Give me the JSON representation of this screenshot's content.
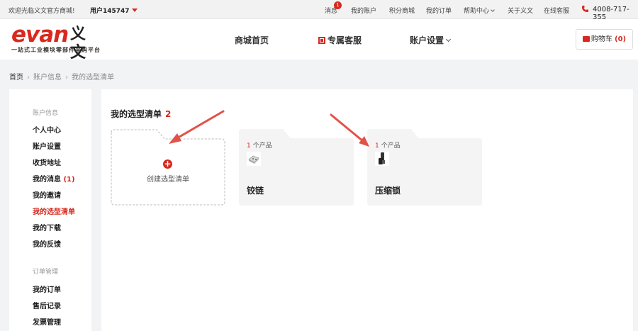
{
  "topbar": {
    "welcome": "欢迎光临义文官方商城!",
    "user": "用户145747",
    "nav": [
      "消息",
      "我的账户",
      "积分商城",
      "我的订单",
      "帮助中心",
      "关于义文",
      "在线客服"
    ],
    "message_badge": "1",
    "phone": "4008-717-355"
  },
  "header": {
    "brand": "evan",
    "brand_cn": "义文",
    "tagline": "一站式工业模块零部件采购平台",
    "nav": [
      "商城首页",
      "专属客服",
      "账户设置"
    ],
    "cart_label": "购物车",
    "cart_count": "(0)"
  },
  "breadcrumb": [
    "首页",
    "账户信息",
    "我的选型清单"
  ],
  "sidebar": {
    "group1_title": "账户信息",
    "group1_items": [
      "个人中心",
      "账户设置",
      "收货地址",
      "我的消息",
      "我的邀请",
      "我的选型清单",
      "我的下载",
      "我的反馈"
    ],
    "message_count": "(1)",
    "group2_title": "订单管理",
    "group2_items": [
      "我的订单",
      "售后记录",
      "发票管理"
    ]
  },
  "main": {
    "title": "我的选型清单",
    "title_count": "2",
    "create_label": "创建选型清单",
    "lists": [
      {
        "count": "1",
        "count_suffix": "个产品",
        "name": "铰链",
        "thumb": "hinge-image"
      },
      {
        "count": "1",
        "count_suffix": "个产品",
        "name": "压缩锁",
        "thumb": "lock-image"
      }
    ]
  },
  "colors": {
    "accent": "#d9281e",
    "card_bg": "#f4f4f4"
  }
}
